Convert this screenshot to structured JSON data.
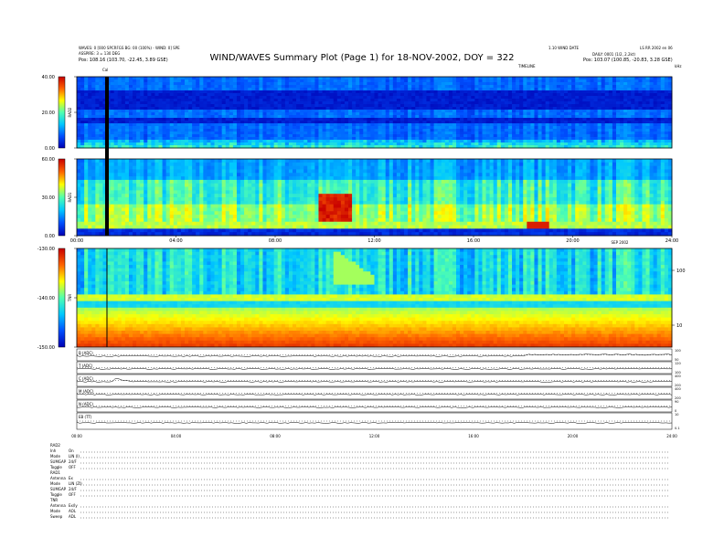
{
  "header": {
    "left_line1": "WAVES: 0 [000 SPCRFGS BG: 00 (100%) - WIND: 0] SPE",
    "left_line2": "ASSPIRE: 3 = 130 DEG",
    "left_pos": "Pos:  108.16 (103.70, -22.45, 3.89 GSE)",
    "title": "WIND/WAVES Summary Plot (Page 1) for 18-NOV-2002, DOY = 322",
    "right_line1": "1.10 WIND DATE",
    "right_line2": "DAILY: 0001 (1/2, 2.2kt)",
    "right_pos": "Pos:  103.07 (100.85, -20.83, 3.28 GSE)",
    "right_corner": "LS RR 2002 en 06",
    "timeline_label": "TIMELINE",
    "mhz_label": "kHz",
    "cal_label": "Cal"
  },
  "chart_data": [
    {
      "type": "heatmap",
      "panel": "RAD2",
      "ylabel": "RAD2",
      "yticks": [
        "40.00",
        "20.00",
        "0.00"
      ],
      "ylim": [
        0,
        40
      ],
      "colorscale": [
        "#0000b4",
        "#0050ff",
        "#00c8ff",
        "#50ffb0",
        "#ffff00",
        "#ff6400",
        "#c80000"
      ]
    },
    {
      "type": "heatmap",
      "panel": "RAD1",
      "ylabel": "RAD1",
      "yticks": [
        "60.00",
        "30.00",
        "0.00"
      ],
      "ylim": [
        0,
        60
      ],
      "xticks": [
        "00:00",
        "04:00",
        "08:00",
        "12:00",
        "16:00",
        "20:00",
        "24:00"
      ],
      "xunit": "SEP 2002"
    },
    {
      "type": "heatmap",
      "panel": "TNR",
      "ylabel": "TNR",
      "yticks": [
        "-130.00",
        "-140.00",
        "-150.00"
      ],
      "ylim": [
        -150,
        -130
      ],
      "right_ticks": [
        "100",
        "10"
      ]
    },
    {
      "type": "line",
      "panel": "housekeeping",
      "series": [
        {
          "name": "B (ADC)",
          "right": [
            "100",
            "50"
          ]
        },
        {
          "name": "T (ADC)",
          "right": [
            "120",
            "100"
          ]
        },
        {
          "name": "C (ADC)",
          "right": [
            "400",
            "200"
          ]
        },
        {
          "name": "M (ADC)",
          "right": [
            "400",
            "200"
          ]
        },
        {
          "name": "N (ADC)",
          "right": [
            "90",
            "0"
          ]
        },
        {
          "name": "EB (TT)",
          "right": [
            "10",
            "0.1"
          ]
        }
      ],
      "xticks": [
        "00:00",
        "04:00",
        "08:00",
        "12:00",
        "16:00",
        "20:00",
        "24:00"
      ]
    }
  ],
  "status": [
    {
      "name": "RAD2",
      "rows": [
        [
          "Inh",
          "On"
        ],
        [
          "Mode",
          "LIN (I)"
        ],
        [
          "SUMGAP",
          "24/F"
        ],
        [
          "Toggle",
          "OFF"
        ]
      ]
    },
    {
      "name": "RAD1",
      "rows": [
        [
          "Antenna",
          "Ex"
        ],
        [
          "Mode",
          "LIN (ZI)"
        ],
        [
          "SUMGAP",
          "24/F"
        ],
        [
          "Toggle",
          "OFF"
        ]
      ]
    },
    {
      "name": "TNR",
      "rows": [
        [
          "Antenna",
          "Ex/ly"
        ],
        [
          "Mode",
          "AOL"
        ],
        [
          "Sweep",
          "ADL"
        ]
      ]
    }
  ]
}
